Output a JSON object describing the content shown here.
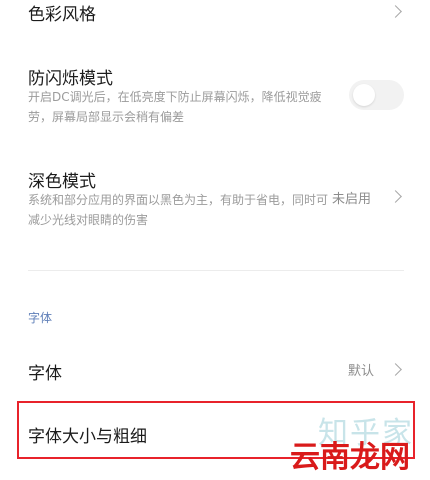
{
  "settings": {
    "color_style": {
      "title": "色彩风格"
    },
    "anti_flicker": {
      "title": "防闪烁模式",
      "description": "开启DC调光后，在低亮度下防止屏幕闪烁，降低视觉疲劳，屏幕局部显示会稍有偏差",
      "enabled": false
    },
    "dark_mode": {
      "title": "深色模式",
      "description": "系统和部分应用的界面以黑色为主，有助于省电，同时可减少光线对眼睛的伤害",
      "value": "未启用"
    }
  },
  "font_section": {
    "header": "字体",
    "font": {
      "title": "字体",
      "value": "默认"
    },
    "font_size_weight": {
      "title": "字体大小与粗细"
    }
  },
  "watermark": {
    "top": "知乎家",
    "bottom": "云南龙网"
  },
  "colors": {
    "highlight_border": "#e8232b",
    "section_header": "#5f7fb8"
  }
}
